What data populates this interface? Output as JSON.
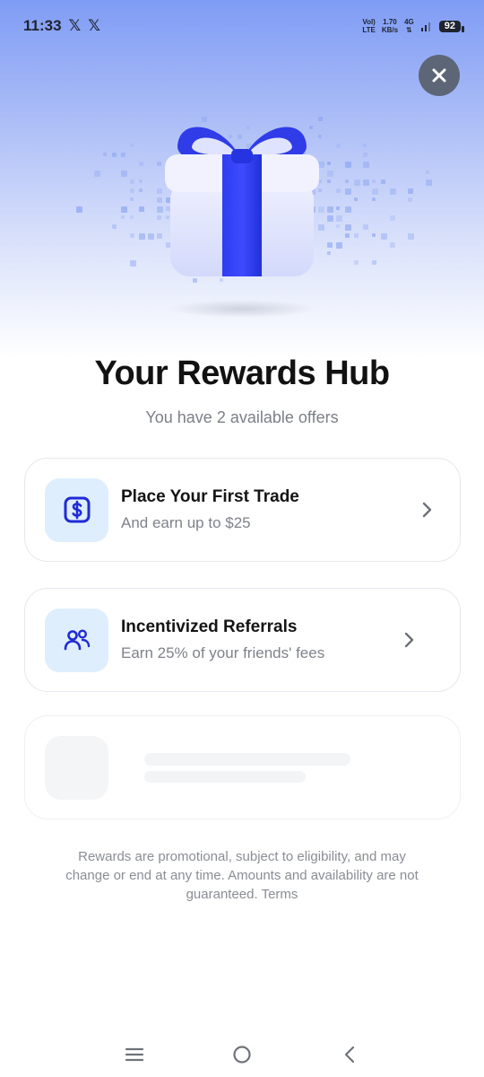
{
  "status_bar": {
    "time": "11:33",
    "notif_icons": [
      "𝕏",
      "𝕏"
    ],
    "volte_top": "Vol)",
    "volte_bottom": "LTE",
    "speed_value": "1.70",
    "speed_unit": "KB/s",
    "network": "4G",
    "battery": "92"
  },
  "hero": {
    "close_icon": "close-icon",
    "illustration": "gift-box"
  },
  "header": {
    "title": "Your Rewards Hub",
    "subtitle": "You have 2 available offers"
  },
  "offers": [
    {
      "title": "Place Your First Trade",
      "description": "And earn up to $25",
      "icon": "dollar-sign-icon"
    },
    {
      "title": "Incentivized Referrals",
      "description": "Earn 25% of your friends' fees",
      "icon": "users-icon"
    }
  ],
  "footer": {
    "disclaimer": "Rewards are promotional, subject to eligibility, and may change or end at any time. Amounts and availability are not guaranteed.",
    "terms_label": "Terms"
  },
  "colors": {
    "accent": "#2b3fe6",
    "icon_bg": "#dfeefc",
    "hero_top": "#7f9cf5"
  },
  "nav": {
    "items": [
      "menu-icon",
      "home-icon",
      "back-icon"
    ]
  }
}
